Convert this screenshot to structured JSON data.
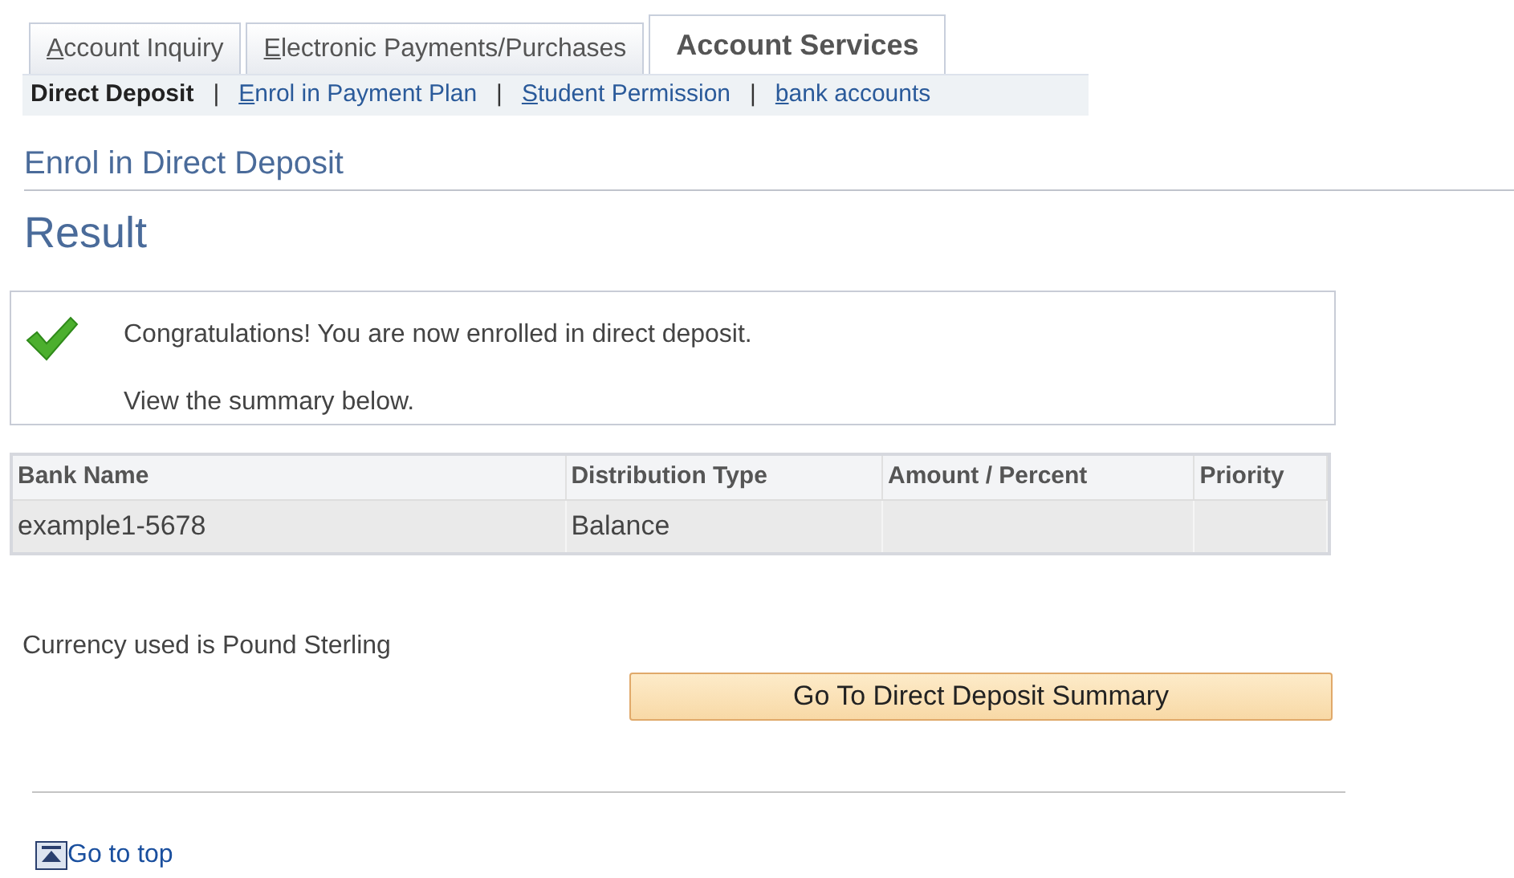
{
  "tabs": [
    {
      "label": "Account Inquiry",
      "selected": false,
      "underline_first": true
    },
    {
      "label": "Electronic Payments/Purchases",
      "selected": false,
      "underline_first": true
    },
    {
      "label": "Account Services",
      "selected": true,
      "underline_first": false
    }
  ],
  "subnav": [
    {
      "label": "Direct Deposit",
      "selected": true,
      "underline_first": false
    },
    {
      "label": "Enrol in Payment Plan",
      "selected": false,
      "underline_first": true
    },
    {
      "label": "Student Permission",
      "selected": false,
      "underline_first": true
    },
    {
      "label": "bank accounts",
      "selected": false,
      "underline_first": true
    }
  ],
  "subnav_separator": "|",
  "page_title": "Enrol in Direct Deposit",
  "section_title": "Result",
  "message": {
    "lines": [
      "Congratulations! You are now enrolled in direct deposit.",
      "View the summary below."
    ]
  },
  "table": {
    "columns": [
      "Bank Name",
      "Distribution Type",
      "Amount / Percent",
      "Priority"
    ],
    "rows": [
      [
        "example1-5678",
        "Balance",
        "",
        ""
      ]
    ]
  },
  "currency_note": "Currency used is Pound Sterling",
  "summary_button": "Go To Direct Deposit Summary",
  "go_to_top": "Go to top"
}
